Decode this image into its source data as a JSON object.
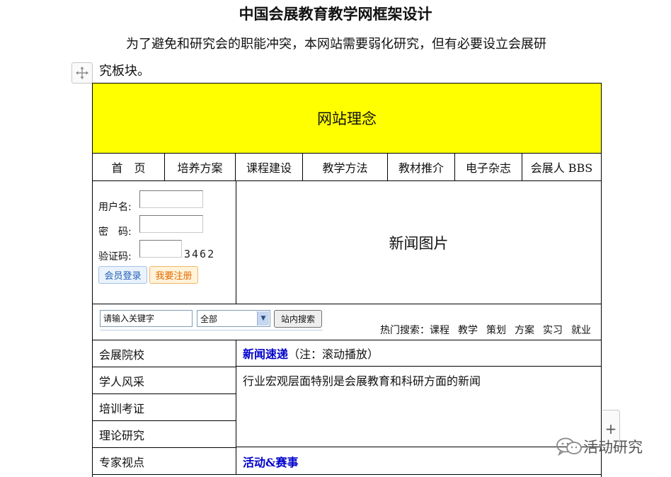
{
  "doc": {
    "title": "中国会展教育教学网框架设计",
    "intro_line1": "为了避免和研究会的职能冲突，本网站需要弱化研究，但有必要设立会展研",
    "intro_line2": "究板块。"
  },
  "banner": "网站理念",
  "nav": [
    "首　页",
    "培养方案",
    "课程建设",
    "教学方法",
    "教材推介",
    "电子杂志",
    "会展人 BBS"
  ],
  "login": {
    "username_label": "用户名:",
    "password_label": "密　码:",
    "captcha_label": "验证码:",
    "captcha_value": "3462",
    "login_button": "会员登录",
    "register_button": "我要注册"
  },
  "news_pic": "新闻图片",
  "search": {
    "input_value": "请输入关键字",
    "select_value": "全部",
    "button": "站内搜索",
    "hot_label": "热门搜索：",
    "hot_items": [
      "课程",
      "教学",
      "策划",
      "方案",
      "实习",
      "就业"
    ]
  },
  "left_menu": [
    "会展院校",
    "学人风采",
    "培训考证",
    "理论研究",
    "专家视点"
  ],
  "news": {
    "heading": "新闻速递",
    "note": "（注：滚动播放）",
    "body": "行业宏观层面特别是会展教育和科研方面的新闻"
  },
  "events": {
    "heading": "活动&赛事"
  },
  "ui": {
    "plus_tab": "+"
  },
  "watermark": "活动研究",
  "colors": {
    "banner": "#ffff00",
    "heading_blue": "#0000cc"
  }
}
